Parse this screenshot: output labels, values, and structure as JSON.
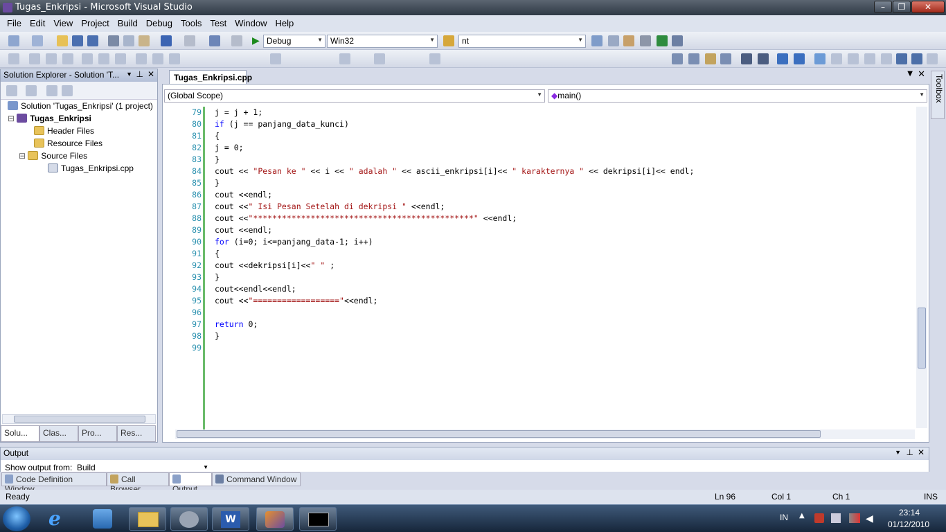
{
  "window": {
    "title": "Tugas_Enkripsi - Microsoft Visual Studio",
    "controls": [
      "minimize",
      "maximize",
      "close"
    ]
  },
  "menu": [
    "File",
    "Edit",
    "View",
    "Project",
    "Build",
    "Debug",
    "Tools",
    "Test",
    "Window",
    "Help"
  ],
  "toolbar": {
    "config": "Debug",
    "platform": "Win32",
    "find": "nt"
  },
  "solution_explorer": {
    "title": "Solution Explorer - Solution 'T...",
    "tree": [
      {
        "label": "Solution 'Tugas_Enkripsi' (1 project)",
        "level": 0
      },
      {
        "label": "Tugas_Enkripsi",
        "level": 1,
        "bold": true
      },
      {
        "label": "Header Files",
        "level": 2
      },
      {
        "label": "Resource Files",
        "level": 2
      },
      {
        "label": "Source Files",
        "level": 2
      },
      {
        "label": "Tugas_Enkripsi.cpp",
        "level": 3
      }
    ],
    "tabs": [
      "Solu...",
      "Clas...",
      "Pro...",
      "Res..."
    ]
  },
  "editor": {
    "tab": "Tugas_Enkripsi.cpp",
    "scope": "(Global Scope)",
    "member": "main()",
    "lines": [
      {
        "n": "79",
        "code": "j = j + 1;"
      },
      {
        "n": "80",
        "code": "if (j == panjang_data_kunci)"
      },
      {
        "n": "81",
        "code": "{"
      },
      {
        "n": "82",
        "code": "j = 0;"
      },
      {
        "n": "83",
        "code": "}"
      },
      {
        "n": "84",
        "code": "cout << \"Pesan ke \" << i << \" adalah \" << ascii_enkripsi[i]<< \" karakternya \" << dekripsi[i]<< endl;"
      },
      {
        "n": "85",
        "code": "}"
      },
      {
        "n": "86",
        "code": "cout <<endl;"
      },
      {
        "n": "87",
        "code": "cout <<\" Isi Pesan Setelah di dekripsi \" <<endl;"
      },
      {
        "n": "88",
        "code": "cout <<\"**********************************************\" <<endl;"
      },
      {
        "n": "89",
        "code": "cout <<endl;"
      },
      {
        "n": "90",
        "code": "for (i=0; i<=panjang_data-1; i++)"
      },
      {
        "n": "91",
        "code": "{"
      },
      {
        "n": "92",
        "code": "cout <<dekripsi[i]<<\" \" ;"
      },
      {
        "n": "93",
        "code": "}"
      },
      {
        "n": "94",
        "code": "cout<<endl<<endl;"
      },
      {
        "n": "95",
        "code": "cout <<\"==================\"<<endl;"
      },
      {
        "n": "96",
        "code": ""
      },
      {
        "n": "97",
        "code": "return 0;"
      },
      {
        "n": "98",
        "code": "}"
      },
      {
        "n": "99",
        "code": ""
      }
    ]
  },
  "output": {
    "title": "Output",
    "show_from_label": "Show output from:",
    "show_from_value": "Build"
  },
  "bottom_tabs": [
    "Code Definition Window",
    "Call Browser",
    "Output",
    "Command Window"
  ],
  "status": {
    "text": "Ready",
    "ln": "Ln 96",
    "col": "Col 1",
    "ch": "Ch 1",
    "mode": "INS"
  },
  "toolbox": "Toolbox",
  "taskbar": {
    "lang": "IN",
    "time": "23:14",
    "date": "01/12/2010"
  }
}
